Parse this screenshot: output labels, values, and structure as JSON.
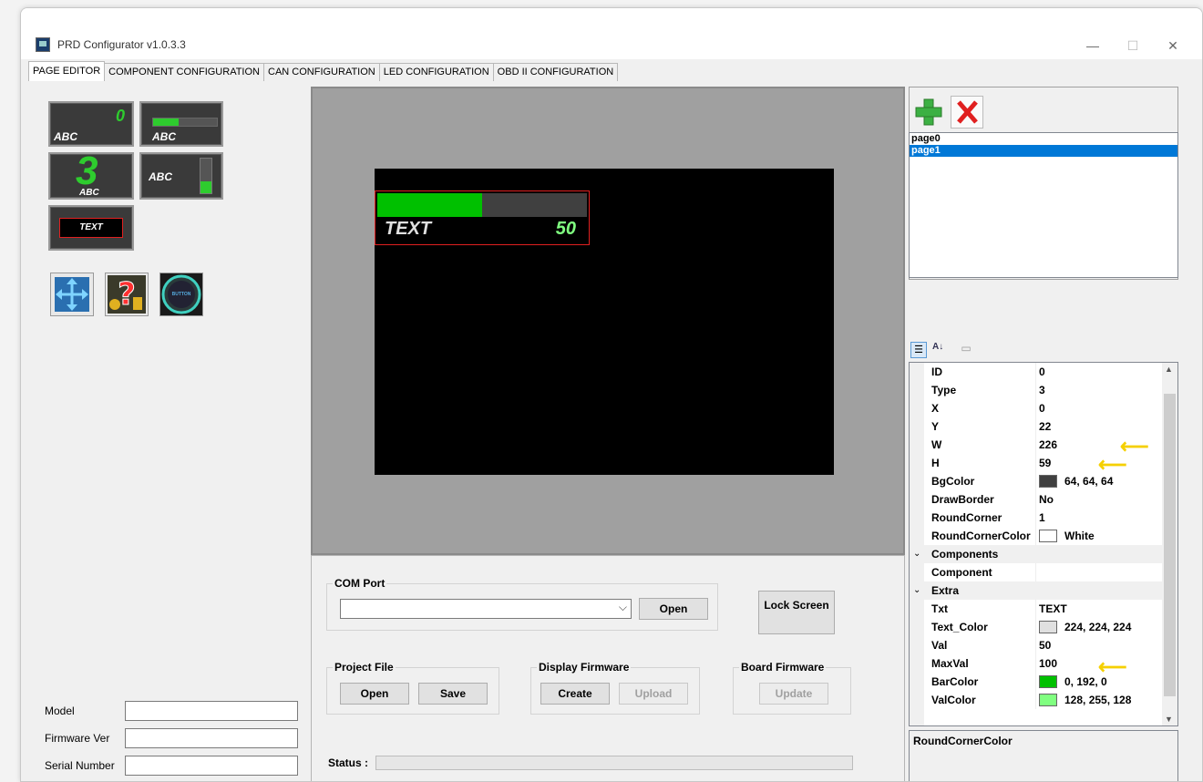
{
  "window": {
    "title": "PRD Configurator v1.0.3.3",
    "minimize": "—",
    "maximize": "☐",
    "close": "✕"
  },
  "tabs": [
    "PAGE EDITOR",
    "COMPONENT CONFIGURATION",
    "CAN CONFIGURATION",
    "LED CONFIGURATION",
    "OBD II CONFIGURATION"
  ],
  "palette": {
    "numeric_widget": {
      "value": "0",
      "label": "ABC"
    },
    "hbar_widget": {
      "label": "ABC"
    },
    "bignum_widget": {
      "value": "3",
      "label": "ABC"
    },
    "vbar_widget": {
      "label": "ABC"
    },
    "text_widget": {
      "label": "TEXT"
    },
    "button_tool": {
      "label": "BUTTON"
    }
  },
  "device_info": {
    "model_label": "Model",
    "model_value": "",
    "firmware_label": "Firmware Ver",
    "firmware_value": "",
    "serial_label": "Serial Number",
    "serial_value": ""
  },
  "preview": {
    "component_text": "TEXT",
    "component_value": "50",
    "bar_fraction": 0.5
  },
  "com_port": {
    "title": "COM Port",
    "selected": "",
    "open_label": "Open"
  },
  "lock_screen_label": "Lock Screen",
  "project_file": {
    "title": "Project File",
    "open_label": "Open",
    "save_label": "Save"
  },
  "display_firmware": {
    "title": "Display Firmware",
    "create_label": "Create",
    "upload_label": "Upload"
  },
  "board_firmware": {
    "title": "Board Firmware",
    "update_label": "Update"
  },
  "status": {
    "label": "Status :",
    "value": ""
  },
  "pages": {
    "items": [
      "page0",
      "page1"
    ],
    "selected": "page1"
  },
  "properties": [
    {
      "name": "ID",
      "value": "0"
    },
    {
      "name": "Type",
      "value": "3"
    },
    {
      "name": "X",
      "value": "0"
    },
    {
      "name": "Y",
      "value": "22"
    },
    {
      "name": "W",
      "value": "226"
    },
    {
      "name": "H",
      "value": "59"
    },
    {
      "name": "BgColor",
      "value": "64, 64, 64",
      "color": "#404040"
    },
    {
      "name": "DrawBorder",
      "value": "No"
    },
    {
      "name": "RoundCorner",
      "value": "1"
    },
    {
      "name": "RoundCornerColor",
      "value": "White",
      "color": "#ffffff"
    },
    {
      "category": "Components"
    },
    {
      "name": "Component",
      "value": ""
    },
    {
      "category": "Extra"
    },
    {
      "name": "Txt",
      "value": "TEXT"
    },
    {
      "name": "Text_Color",
      "value": "224, 224, 224",
      "color": "#e0e0e0"
    },
    {
      "name": "Val",
      "value": "50"
    },
    {
      "name": "MaxVal",
      "value": "100"
    },
    {
      "name": "BarColor",
      "value": "0, 192, 0",
      "color": "#00c000"
    },
    {
      "name": "ValColor",
      "value": "128, 255, 128",
      "color": "#80ff80"
    }
  ],
  "help_text": "RoundCornerColor",
  "colors": {
    "selection": "#0078d7",
    "bar_green": "#00c000",
    "val_green": "#80ff80",
    "highlight_arrow": "#f5d000"
  }
}
